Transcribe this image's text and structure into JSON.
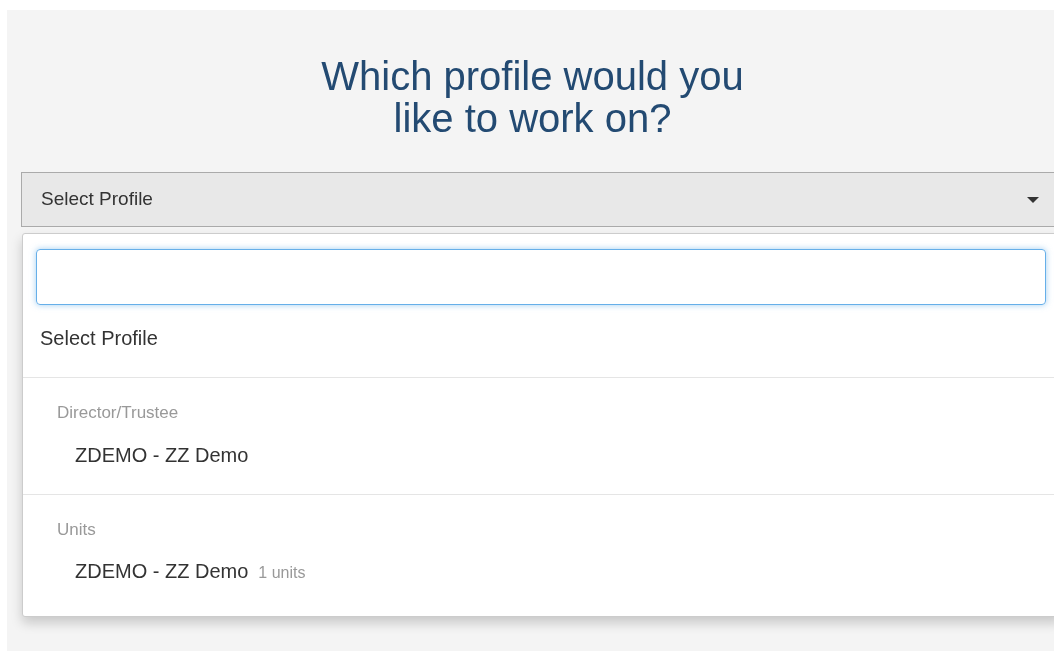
{
  "title": "Which profile would you like to work on?",
  "select": {
    "value": "Select Profile",
    "expanded": true
  },
  "dropdown": {
    "placeholder_option": "Select Profile",
    "groups": [
      {
        "label": "Director/Trustee",
        "options": [
          {
            "label": "ZDEMO - ZZ Demo"
          }
        ]
      },
      {
        "label": "Units",
        "options": [
          {
            "label": "ZDEMO - ZZ Demo",
            "note": "1 units"
          }
        ]
      }
    ]
  }
}
